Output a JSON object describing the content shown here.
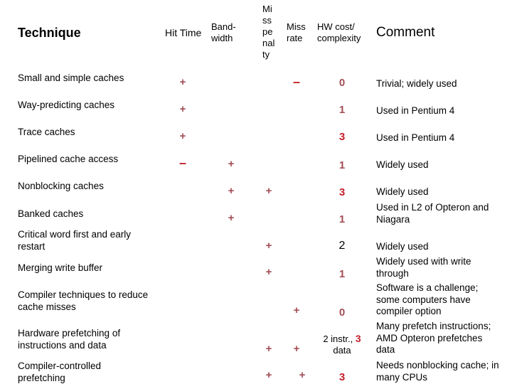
{
  "headers": {
    "technique": "Technique",
    "hit_time": "Hit Time",
    "bandwidth": "Band-\nwidth",
    "miss_penalty": "Mi\nss\npe\nnal\nty",
    "miss_rate": "Miss\nrate",
    "hw_cost": "HW cost/\ncomplexity",
    "comment": "Comment"
  },
  "rows": [
    {
      "technique": "Small and simple caches",
      "hit_time": "+",
      "bandwidth": "",
      "miss_penalty": "",
      "miss_rate": "–",
      "hw_cost": "0",
      "comment": "Trivial; widely used"
    },
    {
      "technique": "Way-predicting caches",
      "hit_time": "+",
      "bandwidth": "",
      "miss_penalty": "",
      "miss_rate": "",
      "hw_cost": "1",
      "comment": "Used in Pentium 4"
    },
    {
      "technique": "Trace caches",
      "hit_time": "+",
      "bandwidth": "",
      "miss_penalty": "",
      "miss_rate": "",
      "hw_cost": "3",
      "comment": "Used in Pentium 4"
    },
    {
      "technique": "Pipelined cache access",
      "hit_time": "–",
      "bandwidth": "+",
      "miss_penalty": "",
      "miss_rate": "",
      "hw_cost": "1",
      "comment": "Widely used"
    },
    {
      "technique": "Nonblocking caches",
      "hit_time": "",
      "bandwidth": "+",
      "miss_penalty": "+",
      "miss_rate": "",
      "hw_cost": "3",
      "comment": "Widely used"
    },
    {
      "technique": "Banked caches",
      "hit_time": "",
      "bandwidth": "+",
      "miss_penalty": "",
      "miss_rate": "",
      "hw_cost": "1",
      "comment": "Used in L2 of Opteron and\nNiagara"
    },
    {
      "technique": "Critical word first and early\nrestart",
      "hit_time": "",
      "bandwidth": "",
      "miss_penalty": "+",
      "miss_rate": "",
      "hw_cost": "2",
      "comment": "Widely used"
    },
    {
      "technique": "Merging write buffer",
      "hit_time": "",
      "bandwidth": "",
      "miss_penalty": "+",
      "miss_rate": "",
      "hw_cost": "1",
      "comment": "Widely used with write\nthrough"
    },
    {
      "technique": "Compiler techniques to reduce\ncache misses",
      "hit_time": "",
      "bandwidth": "",
      "miss_penalty": "",
      "miss_rate": "+",
      "hw_cost": "0",
      "comment": "Software is a challenge;\nsome computers have\ncompiler option"
    },
    {
      "technique": "Hardware prefetching of\ninstructions and data",
      "hit_time": "",
      "bandwidth": "",
      "miss_penalty": "+",
      "miss_rate": "+",
      "hw_cost_prefix": "2 instr., ",
      "hw_cost_highlight": "3",
      "hw_cost_suffix": "data",
      "comment": "Many prefetch instructions;\nAMD Opteron prefetches\ndata"
    },
    {
      "technique": "Compiler-controlled\nprefetching",
      "hit_time": "",
      "bandwidth": "",
      "miss_penalty": "+",
      "miss_rate": "+",
      "hw_cost": "3",
      "comment": "Needs nonblocking cache; in\nmany CPUs"
    }
  ],
  "colors": {
    "plus_marker": "#a34d55",
    "minus_marker": "#c0202a",
    "cost_low": "#a34d55",
    "cost_high": "#c41e2a"
  }
}
